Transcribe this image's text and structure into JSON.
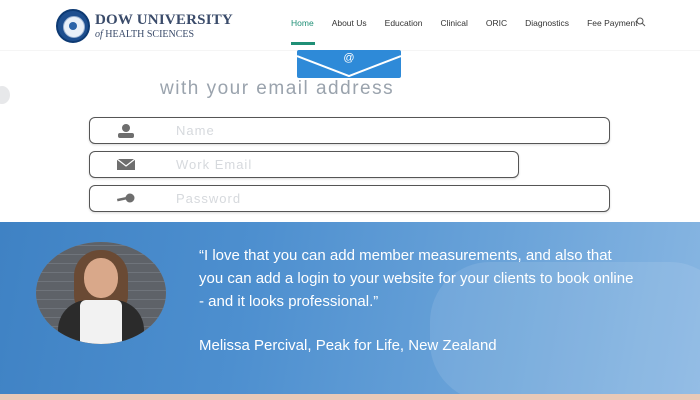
{
  "logo": {
    "line1": "DOW UNIVERSITY",
    "line2_prefix": "of",
    "line2": "HEALTH SCIENCES"
  },
  "nav": {
    "items": [
      {
        "label": "Home",
        "active": true
      },
      {
        "label": "About Us"
      },
      {
        "label": "Education"
      },
      {
        "label": "Clinical"
      },
      {
        "label": "ORIC"
      },
      {
        "label": "Diagnostics"
      },
      {
        "label": "Fee Payment"
      }
    ],
    "search_icon": "search-icon",
    "active_color": "#1f8f76"
  },
  "signup": {
    "envelope_symbol": "@",
    "tagline": "with your email address",
    "fields": {
      "name": {
        "placeholder": "Name",
        "icon": "user-icon"
      },
      "email": {
        "placeholder": "Work Email",
        "icon": "envelope-icon"
      },
      "password": {
        "placeholder": "Password",
        "icon": "key-icon"
      }
    }
  },
  "testimonial": {
    "quote": "“I love that you can add member measurements, and also that you can add a login to your website for your clients to book online - and it looks professional.”",
    "author": "Melissa Percival, Peak for Life, New Zealand",
    "band_color": "#4d8fcf"
  }
}
